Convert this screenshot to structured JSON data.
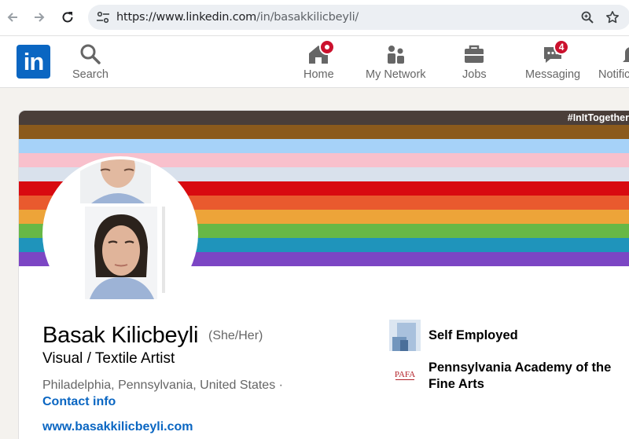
{
  "browser": {
    "url_host": "https://www.linkedin.com",
    "url_path": "/in/basakkilicbeyli/"
  },
  "nav": {
    "search_label": "Search",
    "home_label": "Home",
    "network_label": "My Network",
    "jobs_label": "Jobs",
    "messaging_label": "Messaging",
    "messaging_badge": "4",
    "notifications_label": "Notifications"
  },
  "banner": {
    "hashtag": "#InItTogether",
    "stripe_colors": [
      "#4a3e39",
      "#8b5a1c",
      "#a6d2f8",
      "#f8c0cc",
      "#ffffff",
      "#d80a10",
      "#e95a2e",
      "#eda439",
      "#67b846",
      "#1f94bb",
      "#7c46c4"
    ]
  },
  "profile": {
    "name": "Basak Kilicbeyli",
    "pronouns": "(She/Her)",
    "headline": "Visual / Textile Artist",
    "location": "Philadelphia, Pennsylvania, United States ·",
    "contact_label": "Contact info",
    "website": "www.basakkilicbeyli.com"
  },
  "experience": {
    "current": "Self Employed",
    "education": "Pennsylvania Academy of the Fine Arts",
    "education_logo_text": "PAFA"
  },
  "colors": {
    "brand": "#0a66c2",
    "badge": "#cb112d"
  }
}
